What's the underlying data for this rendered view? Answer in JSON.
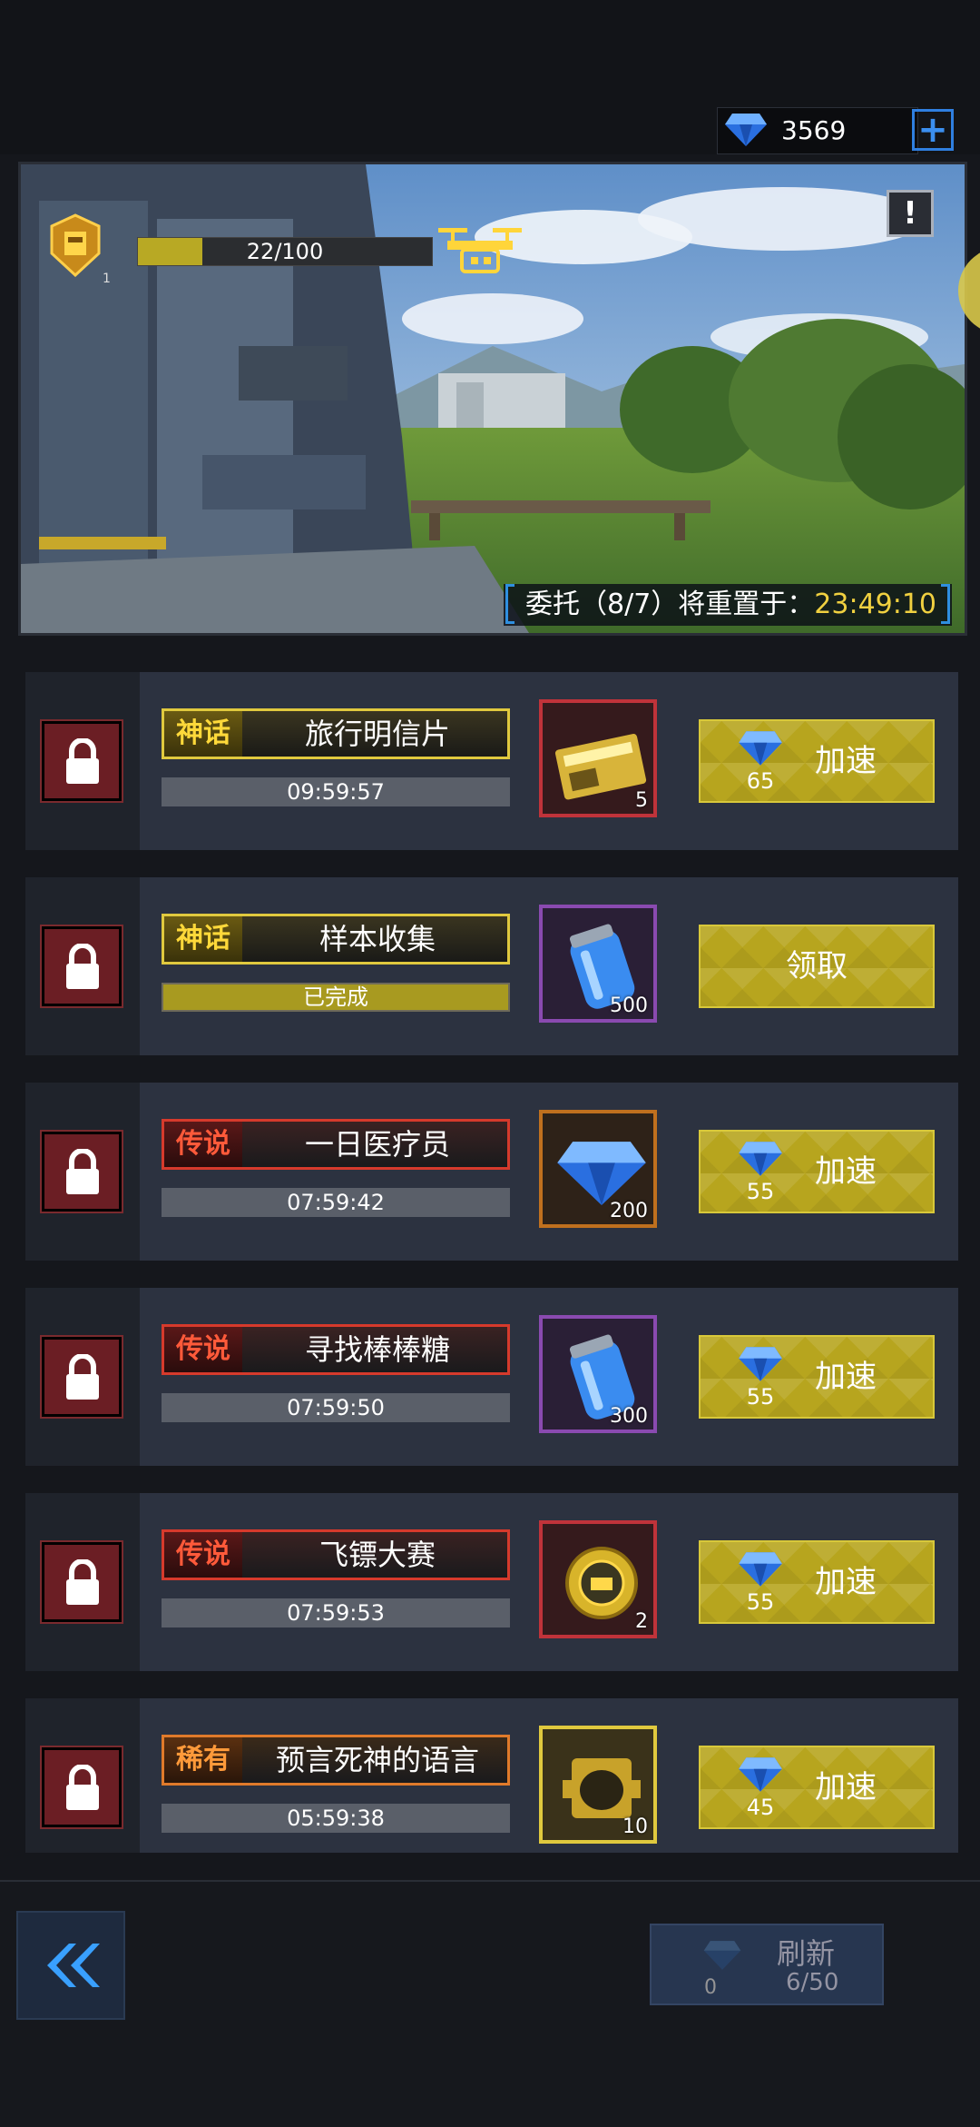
{
  "currency": {
    "gems": "3569",
    "plus_symbol": "+"
  },
  "scene": {
    "level": "1",
    "progress_text": "22/100",
    "progress_fraction": 0.22,
    "info_symbol": "!",
    "reset_label": "委托（8/7）将重置于：",
    "reset_time": "23:49:10"
  },
  "tasks": [
    {
      "rarity": "神话",
      "rarity_class": "mythic",
      "name": "旅行明信片",
      "timer": "09:59:57",
      "reward_icon": "license-ticket-icon",
      "reward_qty": "5",
      "reward_frame": "red",
      "cost": "65",
      "action": "加速"
    },
    {
      "rarity": "神话",
      "rarity_class": "mythic",
      "name": "样本收集",
      "timer": "已完成",
      "reward_icon": "energy-canister-icon",
      "reward_qty": "500",
      "reward_frame": "purple",
      "cost": "",
      "action": "领取"
    },
    {
      "rarity": "传说",
      "rarity_class": "legend",
      "name": "一日医疗员",
      "timer": "07:59:42",
      "reward_icon": "diamond-icon",
      "reward_qty": "200",
      "reward_frame": "orange",
      "cost": "55",
      "action": "加速"
    },
    {
      "rarity": "传说",
      "rarity_class": "legend",
      "name": "寻找棒棒糖",
      "timer": "07:59:50",
      "reward_icon": "energy-canister-icon",
      "reward_qty": "300",
      "reward_frame": "purple",
      "cost": "55",
      "action": "加速"
    },
    {
      "rarity": "传说",
      "rarity_class": "legend",
      "name": "飞镖大赛",
      "timer": "07:59:53",
      "reward_icon": "gold-coin-icon",
      "reward_qty": "2",
      "reward_frame": "red",
      "cost": "55",
      "action": "加速"
    },
    {
      "rarity": "稀有",
      "rarity_class": "rare",
      "name": "预言死神的语言",
      "timer": "05:59:38",
      "reward_icon": "gold-chip-icon",
      "reward_qty": "10",
      "reward_frame": "gold",
      "cost": "45",
      "action": "加速"
    }
  ],
  "bottom": {
    "back_symbol": "«",
    "refresh_label": "刷新",
    "refresh_cost": "0",
    "refresh_count": "6/50"
  }
}
